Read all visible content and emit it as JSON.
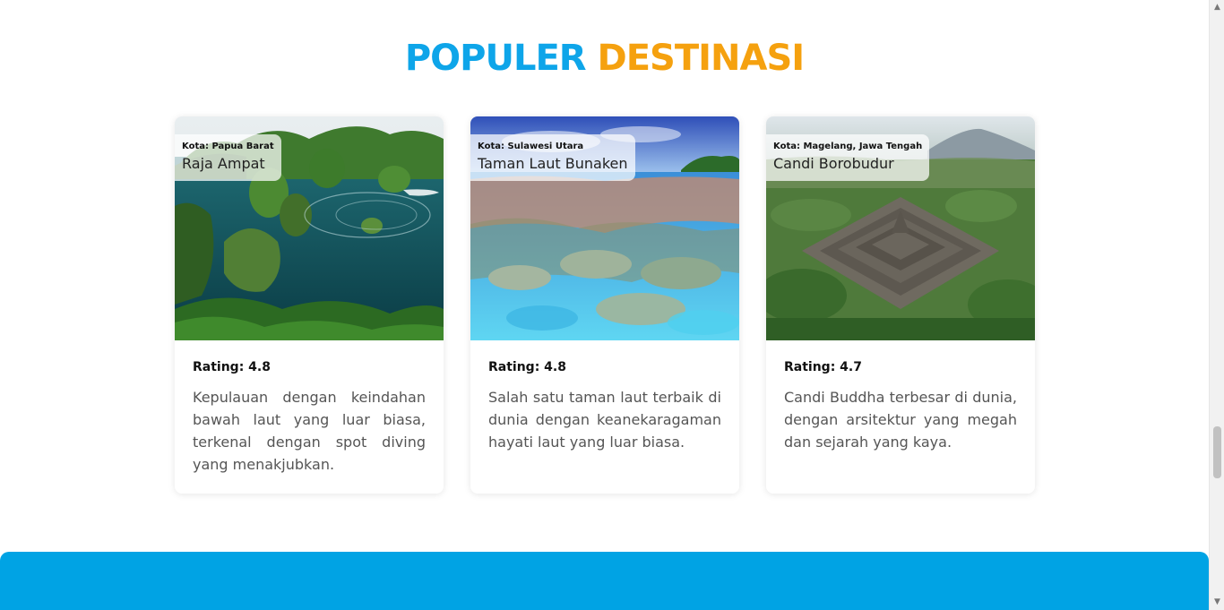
{
  "section": {
    "title_part1": "POPULER",
    "title_part2": "DESTINASI"
  },
  "colors": {
    "title_blue": "#0ea5e9",
    "title_orange": "#f5a10f",
    "footer_blue": "#00a3e4"
  },
  "destinations": [
    {
      "city": "Kota: Papua Barat",
      "name": "Raja Ampat",
      "rating": "Rating: 4.8",
      "description": "Kepulauan dengan keindahan bawah laut yang luar biasa, terkenal dengan spot diving yang menakjubkan."
    },
    {
      "city": "Kota: Sulawesi Utara",
      "name": "Taman Laut Bunaken",
      "rating": "Rating: 4.8",
      "description": "Salah satu taman laut terbaik di dunia dengan keanekaragaman hayati laut yang luar biasa."
    },
    {
      "city": "Kota: Magelang, Jawa Tengah",
      "name": "Candi Borobudur",
      "rating": "Rating: 4.7",
      "description": "Candi Buddha terbesar di dunia, dengan arsitektur yang megah dan sejarah yang kaya."
    }
  ],
  "scrollbar": {
    "up_icon": "arrow-up-icon",
    "down_icon": "arrow-down-icon"
  }
}
